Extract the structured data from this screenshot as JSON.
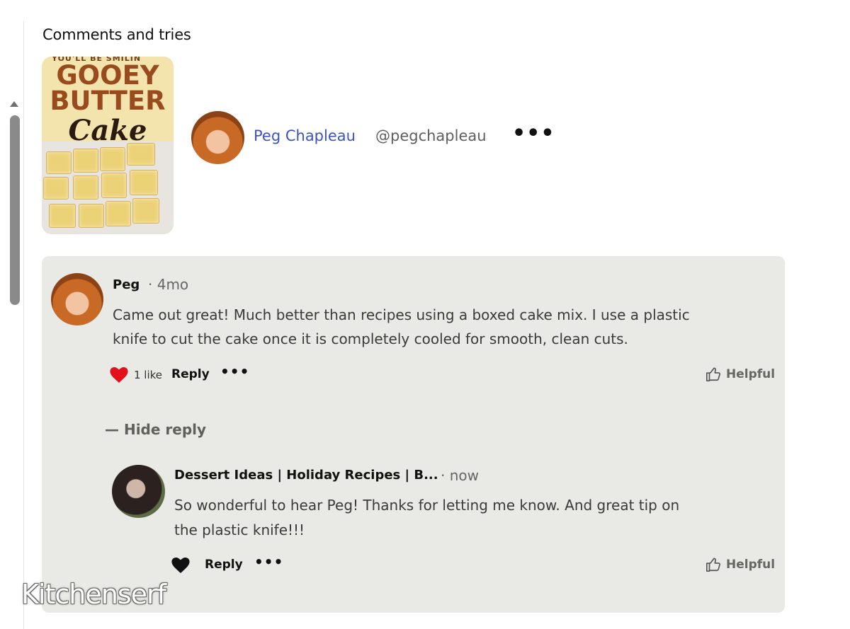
{
  "section": {
    "title": "Comments and tries"
  },
  "recipe_image": {
    "line_top": "YOU'LL BE SMILIN",
    "line1": "GOOEY",
    "line2": "BUTTER",
    "line3": "Cake"
  },
  "author": {
    "name": "Peg Chapleau",
    "handle": "@pegchapleau",
    "more": "•••"
  },
  "comment": {
    "author": "Peg",
    "time": "· 4mo",
    "text_line1": "Came out great! Much better than recipes using a boxed cake mix. I use a plastic",
    "text_line2": "knife to cut the cake once it is completely cooled for smooth, clean cuts.",
    "likes": "1 like",
    "reply": "Reply",
    "more": "•••",
    "helpful": "Helpful",
    "liked": true,
    "like_color": "#e3111a"
  },
  "hide_reply": "— Hide reply",
  "reply": {
    "author": "Dessert Ideas | Holiday Recipes | B...",
    "time": "· now",
    "text_line1": "So wonderful to hear Peg! Thanks for letting me know. And great tip on",
    "text_line2": "the plastic knife!!!",
    "reply": "Reply",
    "more": "•••",
    "helpful": "Helpful",
    "liked": false
  },
  "watermark": "Kitchenserf"
}
